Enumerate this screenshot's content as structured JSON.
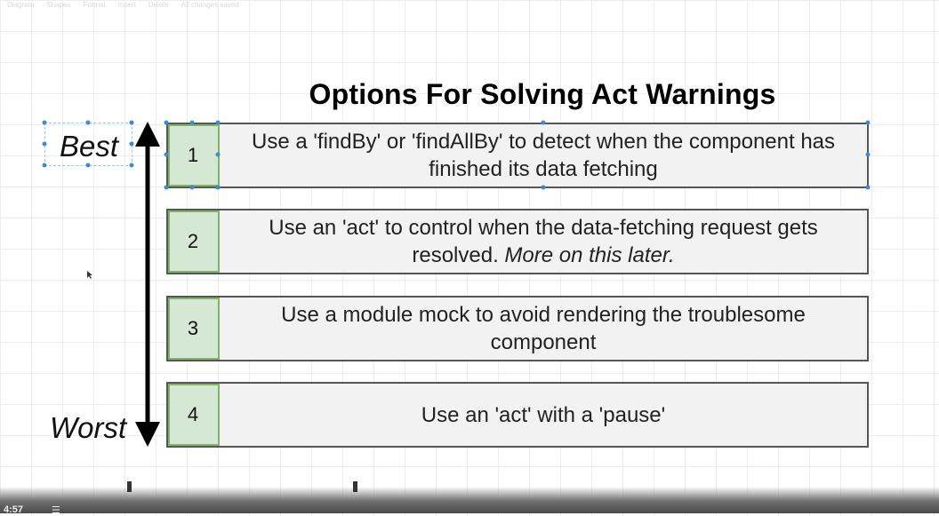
{
  "toolbar": {
    "items": [
      "Diagram",
      "Shapes",
      "Format",
      "Insert",
      "Delete"
    ],
    "status": "All changes saved"
  },
  "title": "Options For Solving Act Warnings",
  "scale": {
    "best": "Best",
    "worst": "Worst"
  },
  "options": [
    {
      "number": "1",
      "text": "Use a 'findBy' or 'findAllBy' to detect when the component has finished its data fetching"
    },
    {
      "number": "2",
      "text": "Use an 'act' to control when the data-fetching request gets resolved.",
      "note": "More on this later."
    },
    {
      "number": "3",
      "text": "Use a module mock to avoid rendering the troublesome component"
    },
    {
      "number": "4",
      "text": "Use an 'act' with a 'pause'"
    }
  ],
  "player": {
    "time": "4:57"
  },
  "colors": {
    "number_fill": "#d5e8d4",
    "number_border": "#82b366",
    "selection": "#3d8bd6"
  }
}
